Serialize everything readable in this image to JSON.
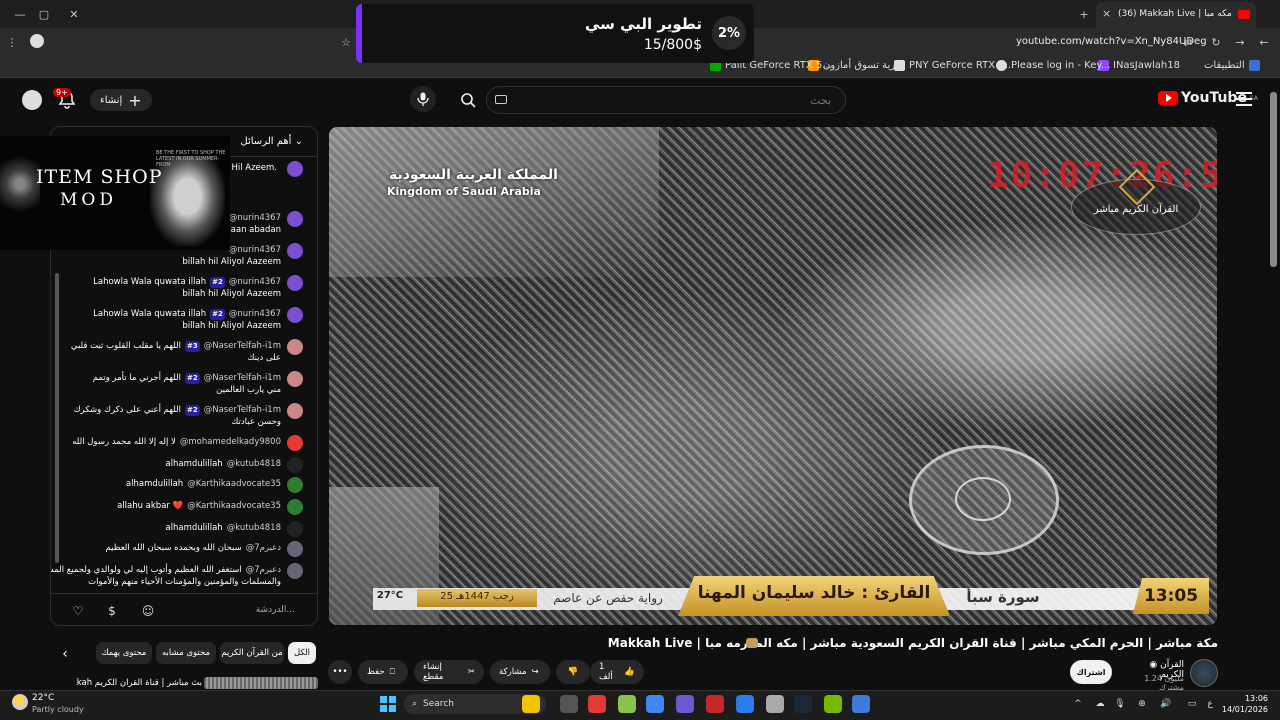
{
  "browser": {
    "tab": {
      "title": "(36) Makkah Live | مكه مبا",
      "count": "36"
    },
    "url": "youtube.com/watch?v=Xn_Ny84UDeg",
    "bookmarks": [
      {
        "label": "التطبيقات",
        "color": "#3a6fd8"
      },
      {
        "label": "INasJawlah18",
        "color": "#9146ff"
      },
      {
        "label": "Please log in - Key...",
        "color": "#d22"
      },
      {
        "label": "PNY GeForce RTX 5...",
        "color": "#555"
      },
      {
        "label": "عرية تسوق أمازون",
        "color": "#f90"
      },
      {
        "label": "Palit GeForce RTX 5...",
        "color": "#0a0"
      }
    ],
    "tab_controls": [
      "×",
      "+"
    ]
  },
  "notification": {
    "title": "تطوير البي سي",
    "progress_text": "15/800$",
    "percent": "2%",
    "progress_fraction": 0.02,
    "accent": "#7b2ff7"
  },
  "youtube": {
    "logo_text": "YouTube",
    "country": "SA",
    "search_placeholder": "بحث",
    "create_label": "إنشاء",
    "notif_count": "9+"
  },
  "item_shop": {
    "title": "ITEM SHOP",
    "subtitle": "MOD",
    "note": "BE THE FIRST TO SHOP THE LATEST IN OUR SUMMER-FROM"
  },
  "chat": {
    "header": "أهم الرسائل",
    "input_placeholder": "الدردشة...",
    "messages": [
      {
        "user": "",
        "badge": "",
        "text": "h Hil Azeem.",
        "text2": "",
        "color": "#7a4fd0"
      },
      {
        "user": "@nurin4367",
        "badge": "",
        "text": "",
        "text2": "iiaan abadan",
        "color": "#7a4fd0"
      },
      {
        "user": "@nurin4367",
        "badge": "",
        "text": "",
        "text2": "billah hil Aliyol Aazeem",
        "color": "#7a4fd0"
      },
      {
        "user": "@nurin4367",
        "badge": "#2",
        "text": "Lahowla Wala quwata illah",
        "text2": "billah hil Aliyol Aazeem",
        "color": "#7a4fd0"
      },
      {
        "user": "@nurin4367",
        "badge": "#2",
        "text": "Lahowla Wala quwata illah",
        "text2": "billah hil Aliyol Aazeem",
        "color": "#7a4fd0"
      },
      {
        "user": "@NaserTelfah-i1m",
        "badge": "#3",
        "text": "اللهم يا مقلب القلوب ثبت قلبي",
        "text2": "على دينك",
        "color": "#c88"
      },
      {
        "user": "@NaserTelfah-i1m",
        "badge": "#2",
        "text": "اللهم أجرني ما تأمر وتمم",
        "text2": "مني يارب العالمين",
        "color": "#c88"
      },
      {
        "user": "@NaserTelfah-i1m",
        "badge": "#2",
        "text": "اللهم أعني على ذكرك وشكرك",
        "text2": "وحسن عبادتك",
        "color": "#c88"
      },
      {
        "user": "@mohamedelkady9800",
        "badge": "",
        "text": "لا إله إلا الله محمد رسول الله",
        "text2": "",
        "color": "#e53935"
      },
      {
        "user": "@kutub4818",
        "badge": "",
        "text": "alhamdulillah",
        "text2": "",
        "color": "#222"
      },
      {
        "user": "@Karthikaadvocate35",
        "badge": "",
        "text": "alhamdulillah",
        "text2": "",
        "color": "#2e7d32"
      },
      {
        "user": "@Karthikaadvocate35",
        "badge": "",
        "text": "allahu akbar ❤️",
        "text2": "",
        "color": "#2e7d32"
      },
      {
        "user": "@kutub4818",
        "badge": "",
        "text": "alhamdulillah",
        "text2": "",
        "color": "#222"
      },
      {
        "user": "@دعبرم7",
        "badge": "",
        "text": "سبحان الله وبحمده سبحان الله العظيم",
        "text2": "",
        "color": "#667"
      },
      {
        "user": "@دعبرم7",
        "badge": "",
        "text": "استغفر الله العظيم وأتوب إليه لي ولوالدي ولجميع المسلمين",
        "text2": "والمسلمات والمؤمنين والمؤمنات الأحياء منهم والأموات",
        "color": "#667"
      }
    ]
  },
  "video": {
    "overlay_country_ar": "المملكة العربية السعودية",
    "overlay_country_en": "Kingdom of Saudi Arabia",
    "clock": "10:07:26:57",
    "channel_watermark": "القرآن الكريم مباشر",
    "reciter": "القارئ : خالد سليمان المهنا",
    "surah": "سورة سبأ",
    "riwaya": "رواية حفص عن عاصم",
    "hijri_date": "25 رجب 1447هـ",
    "temperature": "27°C",
    "time": "13:05",
    "title": "مكة مباشر | الحرم المكي مباشر | قناة القران الكريم السعودية مباشر | مكه المكرمه مبا | Makkah Live"
  },
  "channel": {
    "name": "القرآن الكريم",
    "subscribers": "1.24 مليون مشترك",
    "subscribe_label": "اشتراك"
  },
  "actions": {
    "like_count": "1 ألف",
    "share": "مشاركة",
    "clip": "إنشاء مقطع",
    "save": "حفظ",
    "more": "•••"
  },
  "chips": [
    "الكل",
    "من القرآن الكريم",
    "محتوى مشابه",
    "محتوى يهمك"
  ],
  "recommendation": {
    "title": "بث مباشر | قناة القرآن الكريم Makkah"
  },
  "taskbar": {
    "weather_temp": "22°C",
    "weather_desc": "Partly cloudy",
    "search_label": "Search",
    "time": "13:06",
    "date": "14/01/2026",
    "apps": [
      "#f0c400",
      "#555",
      "#e53935",
      "#8bc34a",
      "#4285f4",
      "#6a5acd",
      "#c62828",
      "#2b7de9",
      "#aaa",
      "#1b2838",
      "#76b900",
      "#3e7bd8"
    ]
  }
}
